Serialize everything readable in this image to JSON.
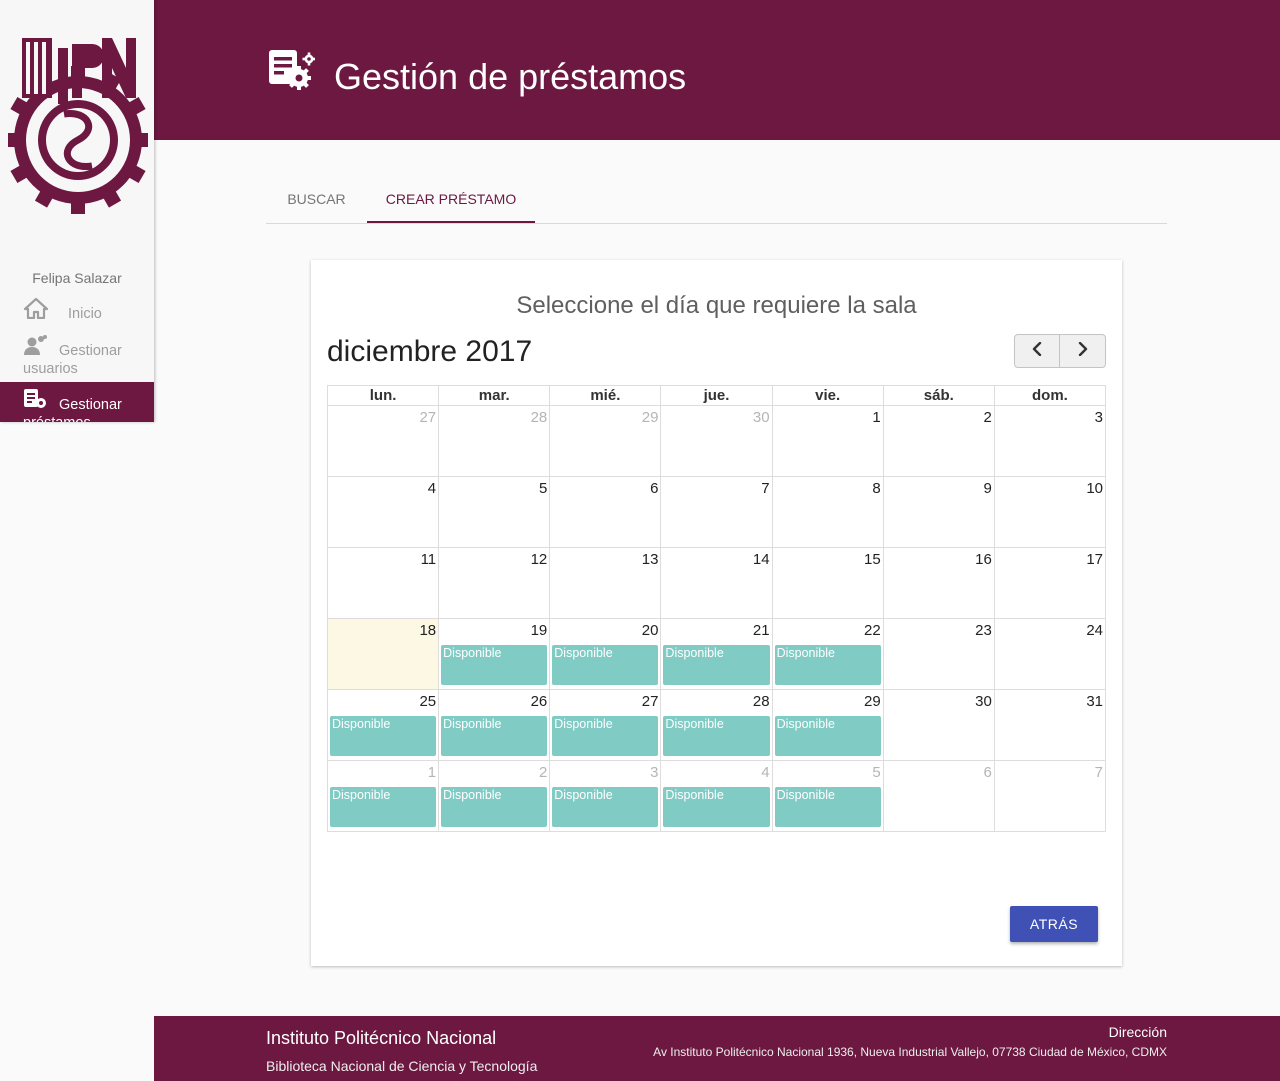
{
  "sidebar": {
    "user_name": "Felipa Salazar",
    "items": [
      {
        "label": "Inicio",
        "icon": "home-icon"
      },
      {
        "label": "Gestionar usuarios",
        "icon": "users-icon"
      },
      {
        "label": "Gestionar préstamos",
        "icon": "document-gear-icon"
      }
    ],
    "active": "Gestionar préstamos"
  },
  "header": {
    "title": "Gestión de préstamos",
    "icon": "document-gear-icon"
  },
  "tabs": [
    {
      "label": "BUSCAR",
      "active": false
    },
    {
      "label": "CREAR PRÉSTAMO",
      "active": true
    }
  ],
  "card": {
    "title": "Seleccione el día que requiere la sala",
    "month": "diciembre 2017",
    "prev_icon": "chevron-left-icon",
    "next_icon": "chevron-right-icon",
    "weekdays": [
      "lun.",
      "mar.",
      "mié.",
      "jue.",
      "vie.",
      "sáb.",
      "dom."
    ],
    "weeks": [
      [
        {
          "d": "27",
          "other": true
        },
        {
          "d": "28",
          "other": true
        },
        {
          "d": "29",
          "other": true
        },
        {
          "d": "30",
          "other": true
        },
        {
          "d": "1"
        },
        {
          "d": "2"
        },
        {
          "d": "3"
        }
      ],
      [
        {
          "d": "4"
        },
        {
          "d": "5"
        },
        {
          "d": "6"
        },
        {
          "d": "7"
        },
        {
          "d": "8"
        },
        {
          "d": "9"
        },
        {
          "d": "10"
        }
      ],
      [
        {
          "d": "11"
        },
        {
          "d": "12"
        },
        {
          "d": "13"
        },
        {
          "d": "14"
        },
        {
          "d": "15"
        },
        {
          "d": "16"
        },
        {
          "d": "17"
        }
      ],
      [
        {
          "d": "18",
          "today": true
        },
        {
          "d": "19",
          "event": "Disponible"
        },
        {
          "d": "20",
          "event": "Disponible"
        },
        {
          "d": "21",
          "event": "Disponible"
        },
        {
          "d": "22",
          "event": "Disponible"
        },
        {
          "d": "23"
        },
        {
          "d": "24"
        }
      ],
      [
        {
          "d": "25",
          "event": "Disponible"
        },
        {
          "d": "26",
          "event": "Disponible"
        },
        {
          "d": "27",
          "event": "Disponible"
        },
        {
          "d": "28",
          "event": "Disponible"
        },
        {
          "d": "29",
          "event": "Disponible"
        },
        {
          "d": "30"
        },
        {
          "d": "31"
        }
      ],
      [
        {
          "d": "1",
          "other": true,
          "event": "Disponible"
        },
        {
          "d": "2",
          "other": true,
          "event": "Disponible"
        },
        {
          "d": "3",
          "other": true,
          "event": "Disponible"
        },
        {
          "d": "4",
          "other": true,
          "event": "Disponible"
        },
        {
          "d": "5",
          "other": true,
          "event": "Disponible"
        },
        {
          "d": "6",
          "other": true
        },
        {
          "d": "7",
          "other": true
        }
      ]
    ],
    "back_label": "ATRÁS"
  },
  "footer": {
    "institution": "Instituto Politécnico Nacional",
    "library": "Biblioteca Nacional de Ciencia y Tecnología",
    "direction_label": "Dirección",
    "address": "Av Instituto Politécnico Nacional 1936, Nueva Industrial Vallejo, 07738 Ciudad de México, CDMX"
  },
  "colors": {
    "brand": "#6c1841",
    "event": "#80cbc4",
    "today": "#fcf8e3",
    "primary_button": "#3f51b5"
  }
}
